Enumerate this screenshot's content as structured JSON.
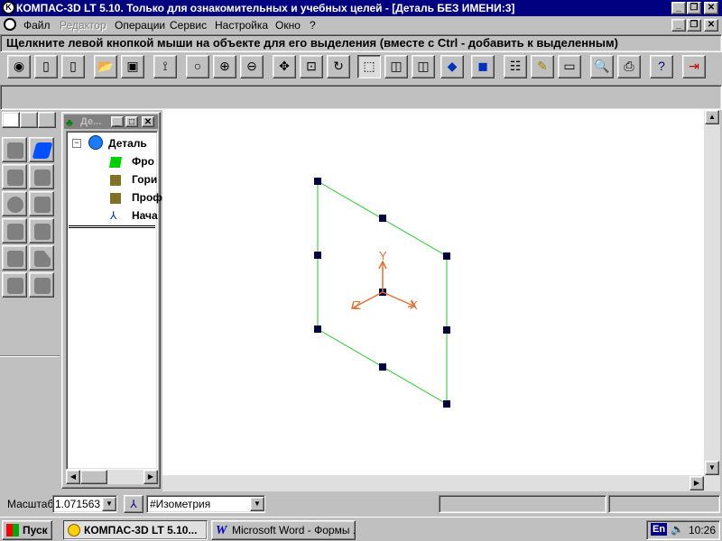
{
  "window": {
    "title": "КОМПАС-3D LT 5.10. Только для ознакомительных и учебных целей - [Деталь БЕЗ ИМЕНИ:3]",
    "icon_text": "K"
  },
  "menu": {
    "items": [
      "Файл",
      "Редактор",
      "Операции",
      "Сервис",
      "Настройка",
      "Окно",
      "?"
    ]
  },
  "hint": "Щелкните левой кнопкой мыши на объекте для его выделения (вместе с Ctrl - добавить к выделенным)",
  "toolbar": {
    "icons": [
      "camera-icon",
      "new-doc-icon",
      "new-sheet-icon",
      "open-folder-icon",
      "save-disk-icon",
      "select-axes-icon",
      "zoom-icon",
      "zoom-in-icon",
      "zoom-out-icon",
      "pan-icon",
      "zoom-fit-icon",
      "rotate-icon",
      "wireframe-icon",
      "hidden-lines-icon",
      "no-hidden-lines-icon",
      "shaded-icon",
      "perspective-icon",
      "tree-toggle-icon",
      "measure-icon",
      "status-line-icon",
      "print-preview-icon",
      "print-icon",
      "context-help-icon",
      "exit-icon"
    ]
  },
  "tree": {
    "title": "Де...",
    "root": "Деталь",
    "items": [
      "Фро",
      "Гори",
      "Проф",
      "Нача"
    ]
  },
  "status": {
    "scale_label": "Масштаб",
    "scale_value": "1.071563",
    "view_value": "#Изометрия"
  },
  "axes": {
    "x": "X",
    "y": "Y",
    "z": "Z"
  },
  "taskbar": {
    "start": "Пуск",
    "tasks": [
      "КОМПАС-3D LT 5.10...",
      "Microsoft Word - Формы ..."
    ],
    "lang": "En",
    "clock": "10:26"
  },
  "colors": {
    "title_active": "#000080",
    "plane_edge": "#22cc22",
    "axis_orange": "#e07030",
    "handle": "#000040"
  }
}
